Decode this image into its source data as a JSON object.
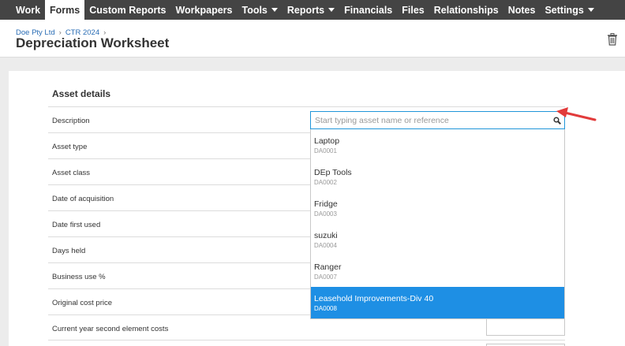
{
  "nav": {
    "items": [
      {
        "label": "Work"
      },
      {
        "label": "Forms"
      },
      {
        "label": "Custom Reports"
      },
      {
        "label": "Workpapers"
      },
      {
        "label": "Tools"
      },
      {
        "label": "Reports"
      },
      {
        "label": "Financials"
      },
      {
        "label": "Files"
      },
      {
        "label": "Relationships"
      },
      {
        "label": "Notes"
      },
      {
        "label": "Settings"
      }
    ],
    "active": "Forms"
  },
  "breadcrumb": {
    "items": [
      "Doe Pty Ltd",
      "CTR 2024"
    ]
  },
  "page": {
    "title": "Depreciation Worksheet"
  },
  "form": {
    "section_title": "Asset details",
    "labels": {
      "description": "Description",
      "asset_type": "Asset type",
      "asset_class": "Asset class",
      "date_of_acquisition": "Date of acquisition",
      "date_first_used": "Date first used",
      "days_held": "Days held",
      "business_use": "Business use %",
      "original_cost_price": "Original cost price",
      "second_element_costs": "Current year second element costs"
    },
    "search": {
      "value": "",
      "placeholder": "Start typing asset name or reference"
    }
  },
  "dropdown": {
    "options": [
      {
        "name": "Laptop",
        "code": "DA0001"
      },
      {
        "name": "DEp Tools",
        "code": "DA0002"
      },
      {
        "name": "Fridge",
        "code": "DA0003"
      },
      {
        "name": "suzuki",
        "code": "DA0004"
      },
      {
        "name": "Ranger",
        "code": "DA0007"
      },
      {
        "name": "Leasehold Improvements-Div 40",
        "code": "DA0008"
      }
    ],
    "selected": "Leasehold Improvements-Div 40"
  },
  "colors": {
    "nav_bg": "#444444",
    "accent": "#1e8fe4",
    "link": "#2a6db5",
    "annotation_arrow": "#e23b3b"
  }
}
